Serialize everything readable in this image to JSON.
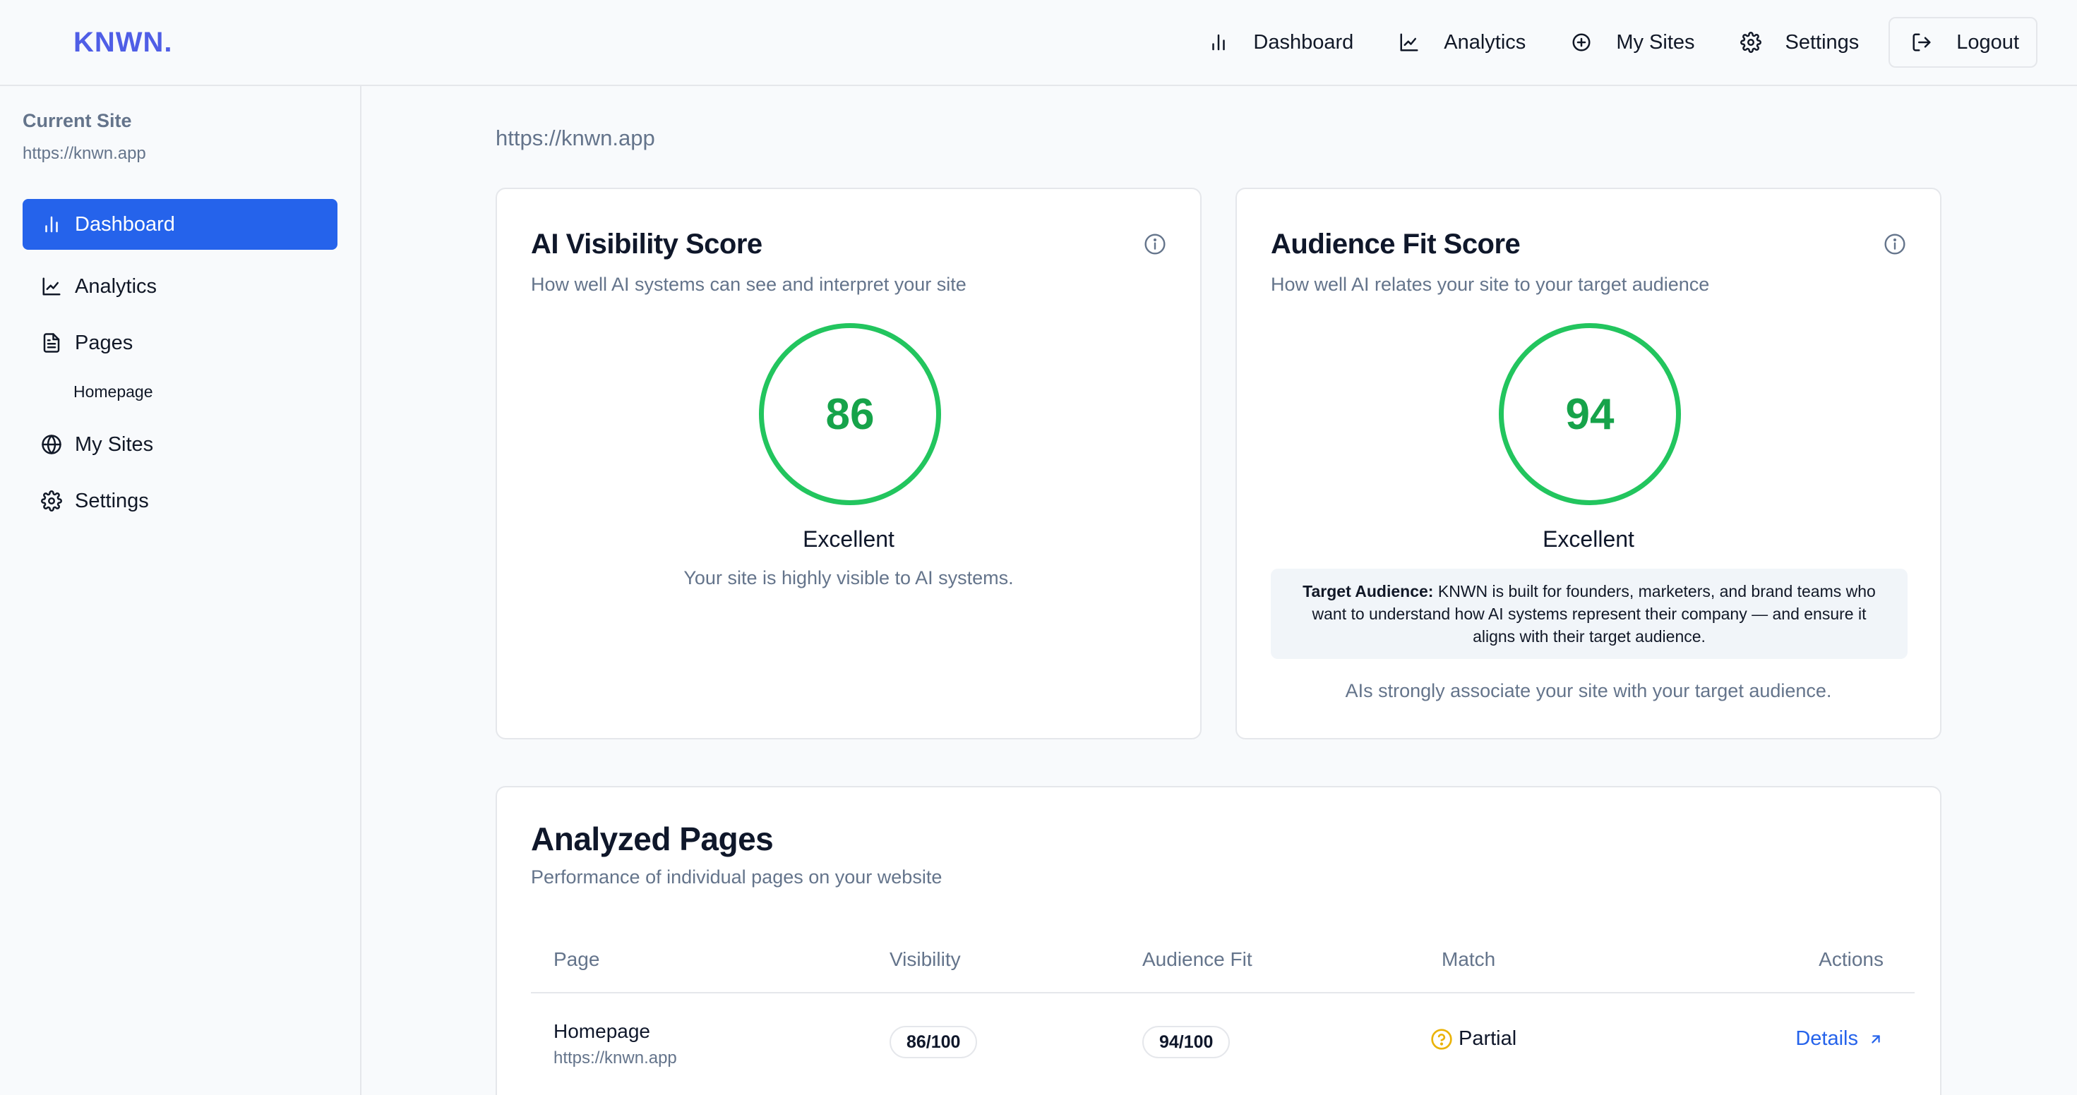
{
  "header": {
    "brand": "KNWN.",
    "nav": [
      {
        "label": "Dashboard",
        "icon": "bar-chart-icon"
      },
      {
        "label": "Analytics",
        "icon": "line-chart-icon"
      },
      {
        "label": "My Sites",
        "icon": "plus-circle-icon"
      },
      {
        "label": "Settings",
        "icon": "gear-icon"
      }
    ],
    "logout_label": "Logout"
  },
  "sidebar": {
    "current_site_label": "Current Site",
    "current_site_url": "https://knwn.app",
    "items": [
      {
        "label": "Dashboard",
        "icon": "bar-chart-icon",
        "active": true
      },
      {
        "label": "Analytics",
        "icon": "line-chart-icon"
      },
      {
        "label": "Pages",
        "icon": "document-icon"
      },
      {
        "label": "My Sites",
        "icon": "globe-icon"
      },
      {
        "label": "Settings",
        "icon": "gear-icon"
      }
    ],
    "pages_sub": [
      "Homepage"
    ]
  },
  "main": {
    "site_url": "https://knwn.app",
    "visibility_card": {
      "title": "AI Visibility Score",
      "subtitle": "How well AI systems can see and interpret your site",
      "score": "86",
      "rating": "Excellent",
      "description": "Your site is highly visible to AI systems."
    },
    "audience_card": {
      "title": "Audience Fit Score",
      "subtitle": "How well AI relates your site to your target audience",
      "score": "94",
      "rating": "Excellent",
      "target_label": "Target Audience:",
      "target_text": "KNWN is built for founders, marketers, and brand teams who want to understand how AI systems represent their company — and ensure it aligns with their target audience.",
      "description": "AIs strongly associate your site with your target audience."
    },
    "pages_table": {
      "title": "Analyzed Pages",
      "subtitle": "Performance of individual pages on your website",
      "columns": [
        "Page",
        "Visibility",
        "Audience Fit",
        "Match",
        "Actions"
      ],
      "rows": [
        {
          "page": "Homepage",
          "url": "https://knwn.app",
          "visibility": "86/100",
          "audience_fit": "94/100",
          "match": "Partial",
          "action": "Details"
        }
      ]
    }
  },
  "colors": {
    "accent": "#2563eb",
    "brand": "#4f5ee6",
    "score_ring": "#22c55e",
    "score_text": "#16a34a",
    "partial": "#eab308"
  }
}
